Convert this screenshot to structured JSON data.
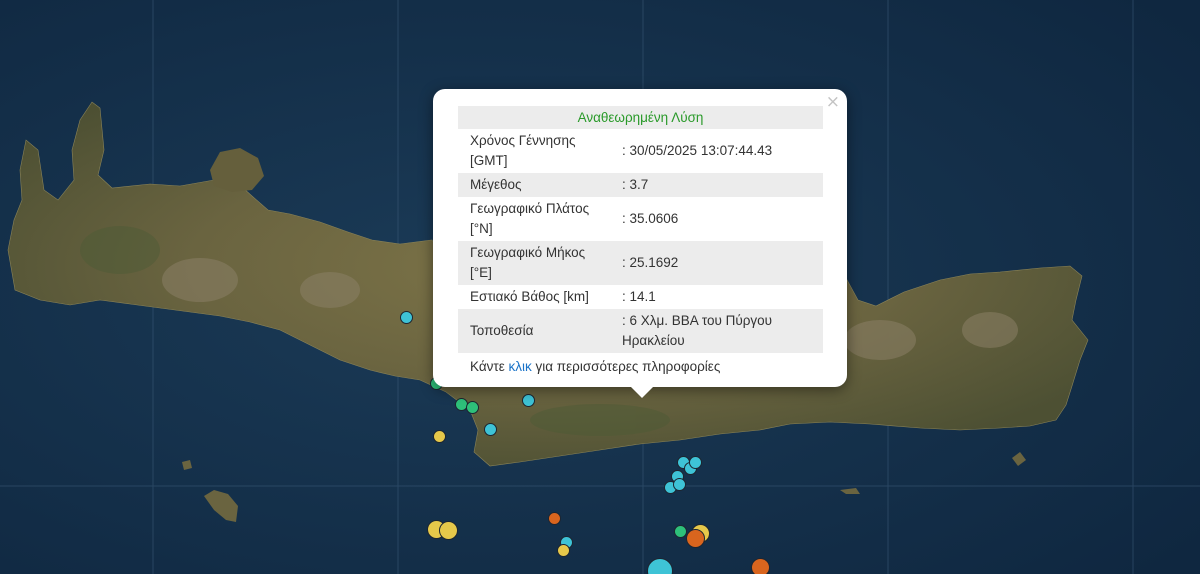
{
  "map": {
    "quakes": [
      {
        "color": "#3ec3d6",
        "size": "small"
      },
      {
        "color": "#2ec07a",
        "size": "small"
      },
      {
        "color": "#2ec07a",
        "size": "small"
      },
      {
        "color": "#2ec07a",
        "size": "small"
      },
      {
        "color": "#e6c84a",
        "size": "small"
      },
      {
        "color": "#3ec3d6",
        "size": "small"
      },
      {
        "color": "#3ec3d6",
        "size": "small"
      },
      {
        "color": "#3ec3d6",
        "size": "small"
      },
      {
        "color": "#3ec3d6",
        "size": "small"
      },
      {
        "color": "#3ec3d6",
        "size": "small"
      },
      {
        "color": "#3ec3d6",
        "size": "small"
      },
      {
        "color": "#3ec3d6",
        "size": "small"
      },
      {
        "color": "#3ec3d6",
        "size": "small"
      },
      {
        "color": "#e6c84a",
        "size": "medium"
      },
      {
        "color": "#e6c84a",
        "size": "medium"
      },
      {
        "color": "#d9651e",
        "size": "small"
      },
      {
        "color": "#3ec3d6",
        "size": "small"
      },
      {
        "color": "#e6c84a",
        "size": "small"
      },
      {
        "color": "#2ec07a",
        "size": "small"
      },
      {
        "color": "#e6c84a",
        "size": "medium"
      },
      {
        "color": "#d9651e",
        "size": "medium"
      },
      {
        "color": "#3ec3d6",
        "size": "large"
      },
      {
        "color": "#d9651e",
        "size": "medium"
      }
    ]
  },
  "popup": {
    "title": "Αναθεωρημένη Λύση",
    "close_icon": "×",
    "rows": [
      {
        "label": "Χρόνος Γέννησης [GMT]",
        "value": ": 30/05/2025 13:07:44.43"
      },
      {
        "label": "Μέγεθος",
        "value": ": 3.7"
      },
      {
        "label": "Γεωγραφικό Πλάτος [°N]",
        "value": ": 35.0606"
      },
      {
        "label": "Γεωγραφικό Μήκος [°E]",
        "value": ": 25.1692"
      },
      {
        "label": "Εστιακό Βάθος [km]",
        "value": ": 14.1"
      },
      {
        "label": "Τοποθεσία",
        "value": ": 6 Χλμ. ΒΒΑ του Πύργου Ηρακλείου"
      }
    ],
    "more_prefix": "Κάντε ",
    "more_link": "κλικ",
    "more_suffix": " για περισσότερες πληροφορίες"
  },
  "colors": {
    "sea": "#14304a",
    "land": "#6e6740",
    "title_green": "#2a9a2a",
    "link_blue": "#1a73c8"
  }
}
